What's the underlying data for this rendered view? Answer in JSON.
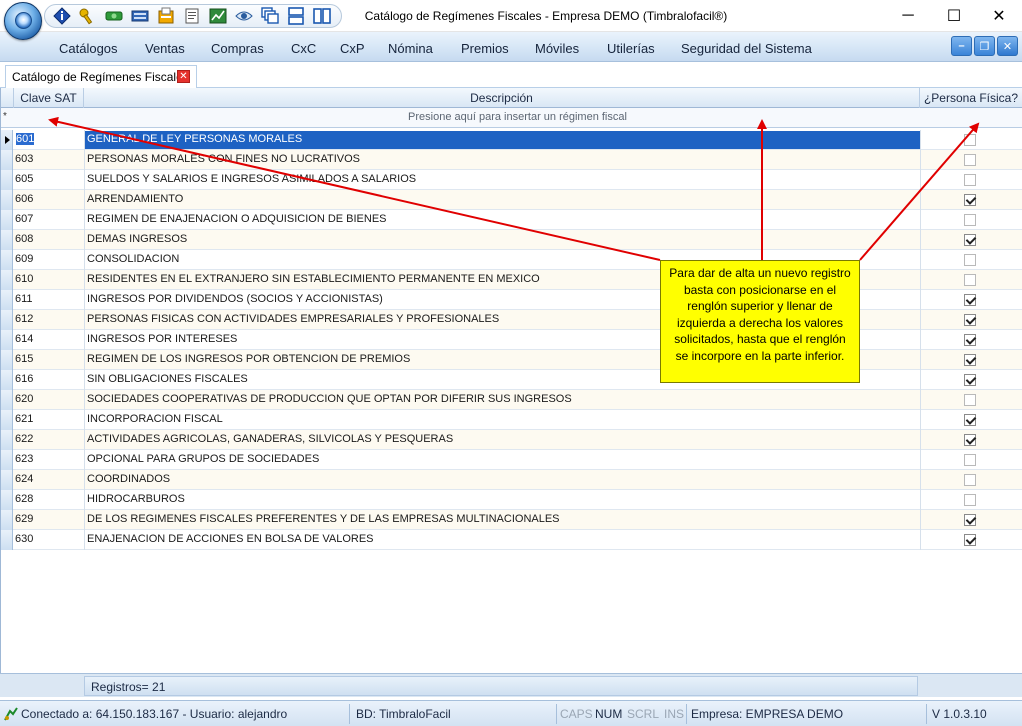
{
  "window": {
    "title": "Catálogo de Regímenes Fiscales - Empresa DEMO (Timbralofacil®)",
    "min_symbol": "─",
    "max_symbol": "☐",
    "close_symbol": "✕"
  },
  "quick_access": [
    {
      "name": "info-icon"
    },
    {
      "name": "key-icon"
    },
    {
      "name": "money-icon"
    },
    {
      "name": "keyboard-icon"
    },
    {
      "name": "invoice-icon"
    },
    {
      "name": "document-icon"
    },
    {
      "name": "chart-icon"
    },
    {
      "name": "eye-icon"
    },
    {
      "name": "cascade-windows-icon"
    },
    {
      "name": "tile-horizontal-icon"
    },
    {
      "name": "tile-vertical-icon"
    }
  ],
  "menu": [
    "Catálogos",
    "Ventas",
    "Compras",
    "CxC",
    "CxP",
    "Nómina",
    "Premios",
    "Móviles",
    "Utilerías",
    "Seguridad del Sistema"
  ],
  "tab": {
    "label": "Catálogo de Regímenes Fiscales",
    "close": "✕"
  },
  "grid": {
    "columns": [
      "Clave SAT",
      "Descripción",
      "¿Persona Física?"
    ],
    "insert_prompt": "Presione aquí para insertar un régimen fiscal",
    "insert_indicator": "*",
    "rows": [
      {
        "clave": "601",
        "descripcion": "GENERAL DE LEY PERSONAS MORALES",
        "persona_fisica": false
      },
      {
        "clave": "603",
        "descripcion": "PERSONAS MORALES CON FINES NO LUCRATIVOS",
        "persona_fisica": false
      },
      {
        "clave": "605",
        "descripcion": "SUELDOS Y SALARIOS E INGRESOS ASIMILADOS A SALARIOS",
        "persona_fisica": false
      },
      {
        "clave": "606",
        "descripcion": "ARRENDAMIENTO",
        "persona_fisica": true
      },
      {
        "clave": "607",
        "descripcion": "REGIMEN DE ENAJENACION O ADQUISICION DE BIENES",
        "persona_fisica": false
      },
      {
        "clave": "608",
        "descripcion": "DEMAS INGRESOS",
        "persona_fisica": true
      },
      {
        "clave": "609",
        "descripcion": "CONSOLIDACION",
        "persona_fisica": false
      },
      {
        "clave": "610",
        "descripcion": "RESIDENTES EN EL EXTRANJERO SIN ESTABLECIMIENTO PERMANENTE EN MEXICO",
        "persona_fisica": false
      },
      {
        "clave": "611",
        "descripcion": "INGRESOS POR DIVIDENDOS (SOCIOS Y ACCIONISTAS)",
        "persona_fisica": true
      },
      {
        "clave": "612",
        "descripcion": "PERSONAS FISICAS CON ACTIVIDADES EMPRESARIALES Y PROFESIONALES",
        "persona_fisica": true
      },
      {
        "clave": "614",
        "descripcion": "INGRESOS POR INTERESES",
        "persona_fisica": true
      },
      {
        "clave": "615",
        "descripcion": "REGIMEN DE LOS INGRESOS POR OBTENCION DE PREMIOS",
        "persona_fisica": true
      },
      {
        "clave": "616",
        "descripcion": "SIN OBLIGACIONES FISCALES",
        "persona_fisica": true
      },
      {
        "clave": "620",
        "descripcion": "SOCIEDADES COOPERATIVAS DE PRODUCCION QUE OPTAN POR DIFERIR SUS INGRESOS",
        "persona_fisica": false
      },
      {
        "clave": "621",
        "descripcion": "INCORPORACION FISCAL",
        "persona_fisica": true
      },
      {
        "clave": "622",
        "descripcion": "ACTIVIDADES AGRICOLAS, GANADERAS, SILVICOLAS Y PESQUERAS",
        "persona_fisica": true
      },
      {
        "clave": "623",
        "descripcion": "OPCIONAL PARA GRUPOS DE SOCIEDADES",
        "persona_fisica": false
      },
      {
        "clave": "624",
        "descripcion": "COORDINADOS",
        "persona_fisica": false
      },
      {
        "clave": "628",
        "descripcion": "HIDROCARBUROS",
        "persona_fisica": false
      },
      {
        "clave": "629",
        "descripcion": "DE LOS REGIMENES FISCALES PREFERENTES Y DE LAS EMPRESAS MULTINACIONALES",
        "persona_fisica": true
      },
      {
        "clave": "630",
        "descripcion": "ENAJENACION DE ACCIONES EN BOLSA DE VALORES",
        "persona_fisica": true
      }
    ],
    "selected_index": 0,
    "footer": "Registros= 21"
  },
  "callout": {
    "text": "Para dar de alta un nuevo registro basta con posicionarse en el renglón superior y llenar de izquierda a derecha los valores solicitados, hasta que el renglón se incorpore en la parte inferior."
  },
  "status": {
    "connection": "Conectado a: 64.150.183.167 - Usuario: alejandro",
    "database": "BD: TimbraloFacil",
    "caps": "CAPS",
    "num": "NUM",
    "scrl": "SCRL",
    "ins": "INS",
    "company": "Empresa: EMPRESA DEMO",
    "version": "V 1.0.3.10"
  },
  "colors": {
    "selection": "#1e62c3",
    "callout": "#ffff00",
    "arrow": "#e00000"
  }
}
